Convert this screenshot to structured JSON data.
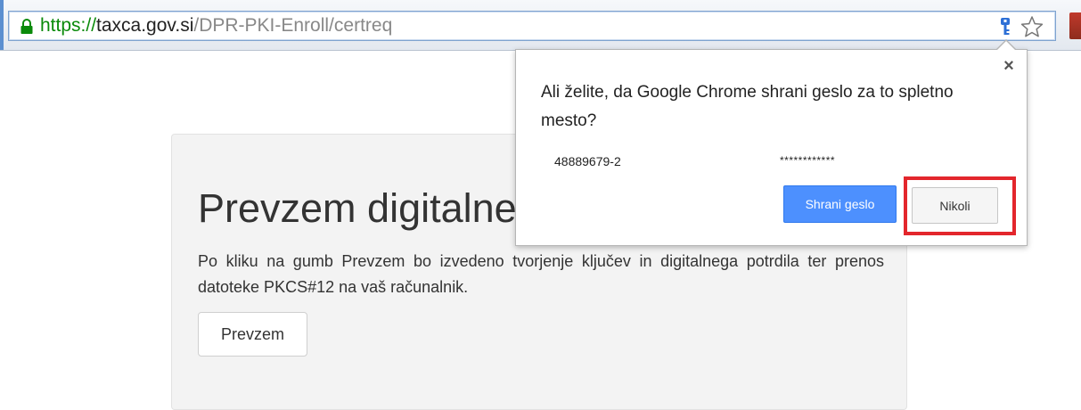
{
  "browser": {
    "url": {
      "scheme": "https://",
      "host": "taxca.gov.si",
      "path": "/DPR-PKI-Enroll/certreq"
    },
    "icons": [
      "lock-icon",
      "key-icon",
      "star-icon"
    ]
  },
  "page": {
    "title": "Prevzem digitalne",
    "description": "Po kliku na gumb Prevzem bo izvedeno tvorjenje ključev in digitalnega potrdila ter prenos datoteke PKCS#12 na vaš računalnik.",
    "button_label": "Prevzem"
  },
  "password_bubble": {
    "close_label": "×",
    "question": "Ali želite, da Google Chrome shrani geslo za to spletno mesto?",
    "username": "48889679-2",
    "password_mask": "************",
    "save_label": "Shrani geslo",
    "never_label": "Nikoli"
  },
  "colors": {
    "secure_green": "#0a8a0a",
    "save_button": "#4d90fe",
    "highlight": "#e3262c"
  }
}
